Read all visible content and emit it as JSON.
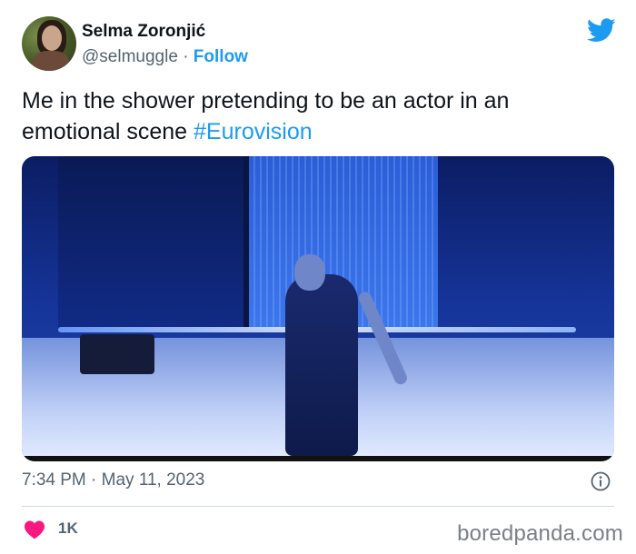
{
  "author": {
    "name": "Selma Zoronjić",
    "handle": "@selmuggle",
    "separator": "·",
    "follow_label": "Follow"
  },
  "tweet": {
    "text": "Me in the shower pretending to be an actor in an emotional scene ",
    "hashtag": "#Eurovision",
    "timestamp": "7:34 PM · May 11, 2023",
    "likes": "1K"
  },
  "watermark": "boredpanda.com",
  "icons": {
    "brand": "twitter-bird-icon",
    "info": "info-icon",
    "like": "heart-icon"
  },
  "colors": {
    "accent": "#1d9bf0",
    "like": "#f91880",
    "secondary_text": "#536471"
  }
}
